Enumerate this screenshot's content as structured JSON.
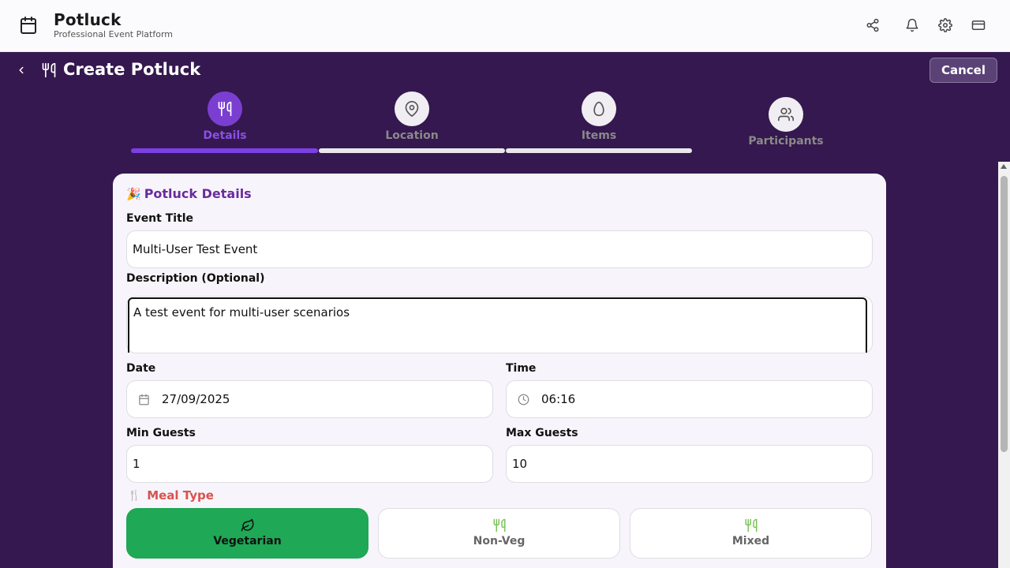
{
  "app": {
    "title": "Potluck",
    "subtitle": "Professional Event Platform",
    "icons": [
      "calendar-icon",
      "share-icon",
      "bell-icon",
      "gear-icon",
      "card-icon"
    ]
  },
  "header": {
    "title": "Create Potluck",
    "cancel_label": "Cancel"
  },
  "stepper": {
    "steps": [
      {
        "label": "Details",
        "icon": "utensils-icon",
        "active": true
      },
      {
        "label": "Location",
        "icon": "map-pin-icon",
        "active": false
      },
      {
        "label": "Items",
        "icon": "egg-icon",
        "active": false
      },
      {
        "label": "Participants",
        "icon": "users-icon",
        "active": false
      }
    ]
  },
  "form": {
    "section_title": "Potluck Details",
    "section_emoji": "🎉",
    "event_title_label": "Event Title",
    "event_title_value": "Multi-User Test Event",
    "description_label": "Description (Optional)",
    "description_value": "A test event for multi-user scenarios",
    "date_label": "Date",
    "date_value": "27/09/2025",
    "time_label": "Time",
    "time_value": "06:16",
    "min_guests_label": "Min Guests",
    "min_guests_value": "1",
    "max_guests_label": "Max Guests",
    "max_guests_value": "10",
    "meal_type_label": "Meal Type",
    "meal_options": [
      {
        "label": "Vegetarian",
        "icon": "leaf-icon",
        "selected": true
      },
      {
        "label": "Non-Veg",
        "icon": "utensils-icon",
        "selected": false
      },
      {
        "label": "Mixed",
        "icon": "utensils-icon",
        "selected": false
      }
    ]
  },
  "colors": {
    "background": "#35184f",
    "accent": "#7b3fe4",
    "selected_meal": "#1fa855",
    "meal_type_label": "#d9534f"
  }
}
